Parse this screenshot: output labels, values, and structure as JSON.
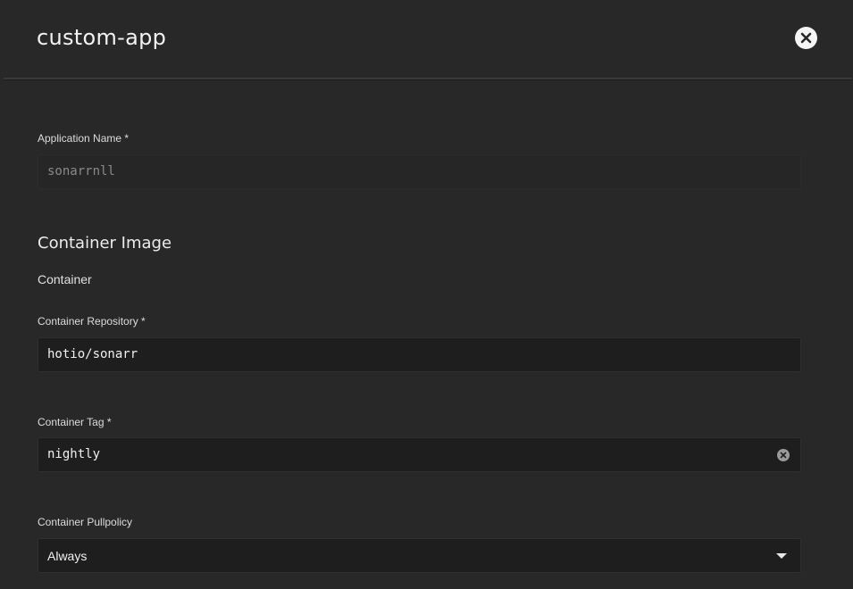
{
  "header": {
    "title": "custom-app"
  },
  "form": {
    "application_name": {
      "label": "Application Name *",
      "value": "sonarrnll"
    },
    "section_title": "Container Image",
    "subsection_title": "Container",
    "repository": {
      "label": "Container Repository *",
      "value": "hotio/sonarr"
    },
    "tag": {
      "label": "Container Tag *",
      "value": "nightly"
    },
    "pullpolicy": {
      "label": "Container Pullpolicy",
      "value": "Always"
    }
  },
  "icons": {
    "close": "close-icon",
    "clear": "clear-icon",
    "dropdown": "chevron-down-icon"
  },
  "colors": {
    "background": "#282828",
    "input_background": "#1e1e1e"
  }
}
